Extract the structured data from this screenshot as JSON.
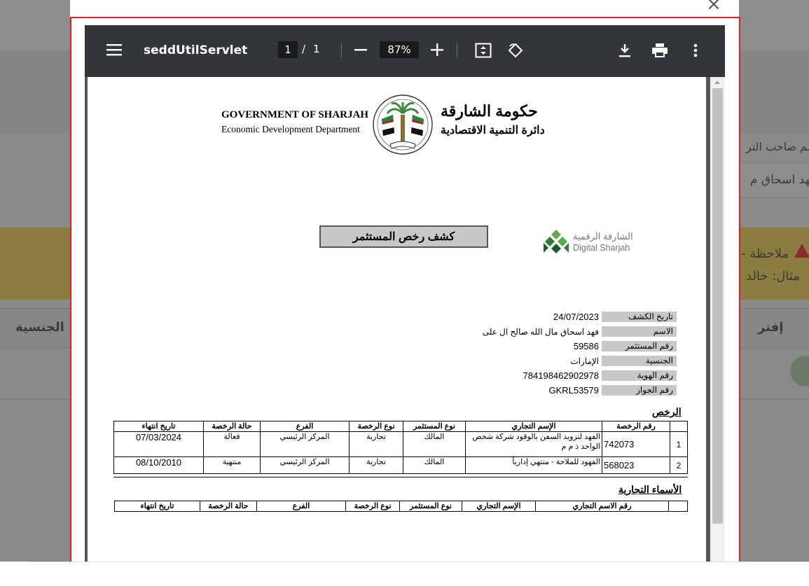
{
  "background": {
    "owner_name_label": "سم صاحب التر",
    "owner_name_value": "فهد اسحاق م",
    "warning_title": "- ملاحظة",
    "warning_example": "مثال: خالد",
    "col_right": "إفتر",
    "col_left": "الجنسية"
  },
  "viewer": {
    "doc_title": "seddUtilServlet",
    "page_current": "1",
    "page_separator": "/",
    "page_total": "1",
    "zoom": "87%"
  },
  "document": {
    "gov_en_line1": "GOVERNMENT OF SHARJAH",
    "gov_en_line2": "Economic Development Department",
    "gov_ar_line1": "حكومة الشارقة",
    "gov_ar_line2": "دائرة التنمية الاقتصادية",
    "digital_ar": "الشارقة الرقمية",
    "digital_en": "Digital Sharjah",
    "report_title": "كشف رخص المستثمر",
    "fields": [
      {
        "label": "تاريخ الكشف",
        "value": "24/07/2023"
      },
      {
        "label": "الاسم",
        "value": "فهد اسحاق مال الله صالح ال على"
      },
      {
        "label": "رقم المستثمر",
        "value": "59586"
      },
      {
        "label": "الجنسية",
        "value": "الإمارات"
      },
      {
        "label": "رقم الهوية",
        "value": "784198462902978"
      },
      {
        "label": "رقم الجواز",
        "value": "GKRL53579"
      }
    ],
    "licenses_heading": "الرخص",
    "licenses_headers": [
      "",
      "رقم الرخصة",
      "الإسم التجاري",
      "نوع المستثمر",
      "نوع الرخصة",
      "الفرع",
      "حالة الرخصة",
      "تاريخ انتهاء"
    ],
    "licenses_rows": [
      [
        "1",
        "742073",
        "الفهد لتزويد السفن بالوقود شركة شخص الواحد ذ م م",
        "المالك",
        "تجارية",
        "المركز الرئيسي",
        "فعالة",
        "07/03/2024"
      ],
      [
        "2",
        "568023",
        "الفهود للملاحة - منتهي إدارياً",
        "المالك",
        "تجارية",
        "المركز الرئيسي",
        "منتهية",
        "08/10/2010"
      ]
    ],
    "tradenames_heading": "الأسماء التجارية",
    "tradenames_headers": [
      "",
      "رقم الاسم التجاري",
      "الإسم التجاري",
      "نوع المستثمر",
      "نوع الرخصة",
      "الفرع",
      "حالة الرخصة",
      "تاريخ انتهاء"
    ]
  }
}
